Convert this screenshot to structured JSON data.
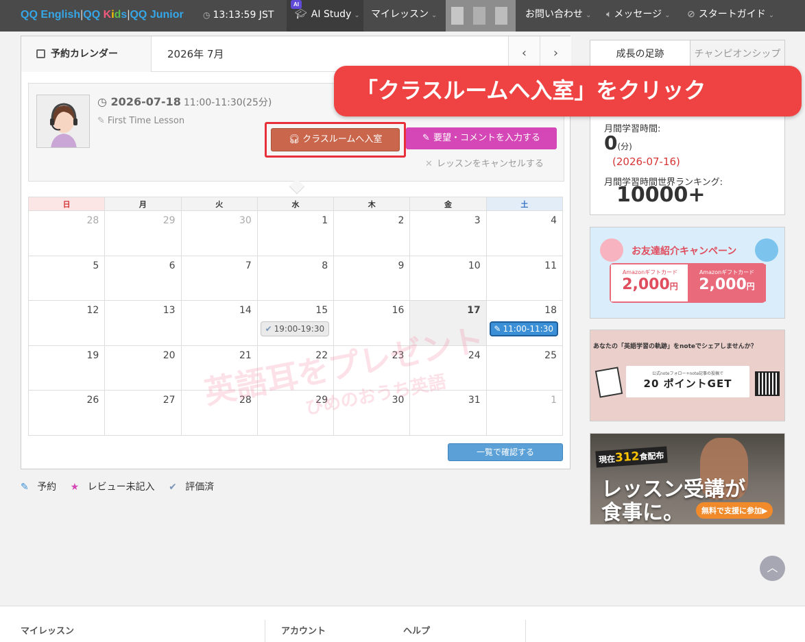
{
  "header": {
    "logo": {
      "qq1": "QQ",
      "english": " English",
      "qq2": "QQ",
      "kids": [
        "K",
        "i",
        "d",
        "s"
      ],
      "qq3": "QQ",
      "junior": " Junior"
    },
    "clock": "13:13:59 JST",
    "ai_badge": "AI",
    "nav": {
      "ai_study": "AI Study",
      "my_lessons": "マイレッスン",
      "contact": "お問い合わせ",
      "messages": "メッセージ",
      "start_guide": "スタートガイド"
    }
  },
  "calendar": {
    "title": "予約カレンダー",
    "month": "2026年 7月",
    "prev": "‹",
    "next": "›",
    "weekdays": [
      "日",
      "月",
      "火",
      "水",
      "木",
      "金",
      "土"
    ],
    "weeks": [
      [
        "28",
        "29",
        "30",
        "1",
        "2",
        "3",
        "4"
      ],
      [
        "5",
        "6",
        "7",
        "8",
        "9",
        "10",
        "11"
      ],
      [
        "12",
        "13",
        "14",
        "15",
        "16",
        "17",
        "18"
      ],
      [
        "19",
        "20",
        "21",
        "22",
        "23",
        "24",
        "25"
      ],
      [
        "26",
        "27",
        "28",
        "29",
        "30",
        "31",
        "1"
      ]
    ],
    "slot_done": "19:00-19:30",
    "slot_booked": "11:00-11:30",
    "list_button": "一覧で確認する",
    "watermark_line1": "英語耳をプレゼント",
    "watermark_line2": "ひめのおうち英語"
  },
  "lesson": {
    "date": "2026-07-18",
    "time": "11:00-11:30(25分)",
    "type": "First Time Lesson",
    "enter_button": "クラスルームへ入室",
    "comment_button": "要望・コメントを入力する",
    "cancel_link": "レッスンをキャンセルする"
  },
  "callout": "「クラスルームへ入室」をクリック",
  "legend": {
    "booked": "予約",
    "review_pending": "レビュー未記入",
    "rated": "評価済"
  },
  "stats": {
    "tab_growth": "成長の足跡",
    "tab_champion": "チャンピオンシップ",
    "monthly_time_label": "月間学習時間:",
    "monthly_time_value": "0",
    "monthly_time_unit": "(分)",
    "date": "(2026-07-16)",
    "ranking_label": "月間学習時間世界ランキング:",
    "ranking_value": "10000+"
  },
  "banners": {
    "referral": {
      "title": "お友達紹介キャンペーン",
      "left_tag": "Amazonギフトカード",
      "left_amount": "2,000",
      "right_tag": "Amazonギフトカード",
      "right_amount": "2,000",
      "yen": "円"
    },
    "note": {
      "title": "あなたの「英語学習の軌跡」をnoteでシェアしませんか？",
      "small": "公式noteフォロー+note記事の投稿で",
      "points": "20 ポイントGET"
    },
    "meal": {
      "count_prefix": "現在",
      "count": "312",
      "count_suffix": "食配布",
      "line1": "レッスン受講が",
      "line2": "食事に。",
      "cta": "無料で支援に参加▶"
    }
  },
  "footer": {
    "my_lessons": "マイレッスン",
    "account": "アカウント",
    "help": "ヘルプ"
  },
  "colors": {
    "nav_bg": "#4a4a4a",
    "enter_button": "#c9664c",
    "comment_button": "#d546b6",
    "callout": "#ef4242",
    "booked_slot": "#3a8fd6",
    "list_button": "#5ba0d6"
  }
}
